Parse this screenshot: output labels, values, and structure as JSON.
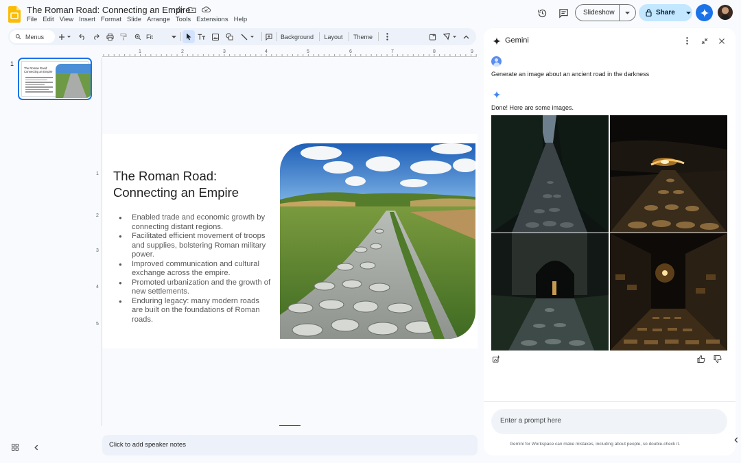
{
  "document": {
    "title": "The Roman Road: Connecting an Empire",
    "menus": [
      "File",
      "Edit",
      "View",
      "Insert",
      "Format",
      "Slide",
      "Arrange",
      "Tools",
      "Extensions",
      "Help"
    ]
  },
  "header_actions": {
    "slideshow_label": "Slideshow",
    "share_label": "Share"
  },
  "toolbar": {
    "search_placeholder": "Menus",
    "zoom_label": "Fit",
    "background_label": "Background",
    "layout_label": "Layout",
    "theme_label": "Theme"
  },
  "filmstrip": {
    "slide_number": "1",
    "thumb_title": "The Roman Road: Connecting an Empire"
  },
  "ruler": {
    "horizontal": [
      "1",
      "2",
      "3",
      "4",
      "5",
      "6",
      "7",
      "8",
      "9"
    ],
    "vertical": [
      "1",
      "2",
      "3",
      "4",
      "5"
    ]
  },
  "slide": {
    "title": "The Roman Road: Connecting an Empire",
    "bullets": [
      "Enabled trade and economic growth by connecting distant regions.",
      "Facilitated efficient movement of troops and supplies, bolstering Roman military power.",
      "Improved communication and cultural exchange across the empire.",
      "Promoted urbanization and the growth of new settlements.",
      "Enduring legacy: many modern roads are built on the foundations of Roman roads."
    ]
  },
  "notes": {
    "placeholder": "Click to add speaker notes"
  },
  "gemini": {
    "title": "Gemini",
    "user_prompt": "Generate an image about an ancient road in the darkness",
    "response": "Done! Here are some images.",
    "input_placeholder": "Enter a prompt here",
    "disclaimer": "Gemini for Workspace can make mistakes, including about people, so double-check it."
  },
  "colors": {
    "accent": "#1a73e8",
    "share_bg": "#c2e7ff",
    "toolbar_bg": "#edf2fa",
    "slides_yellow": "#fbbc04"
  }
}
